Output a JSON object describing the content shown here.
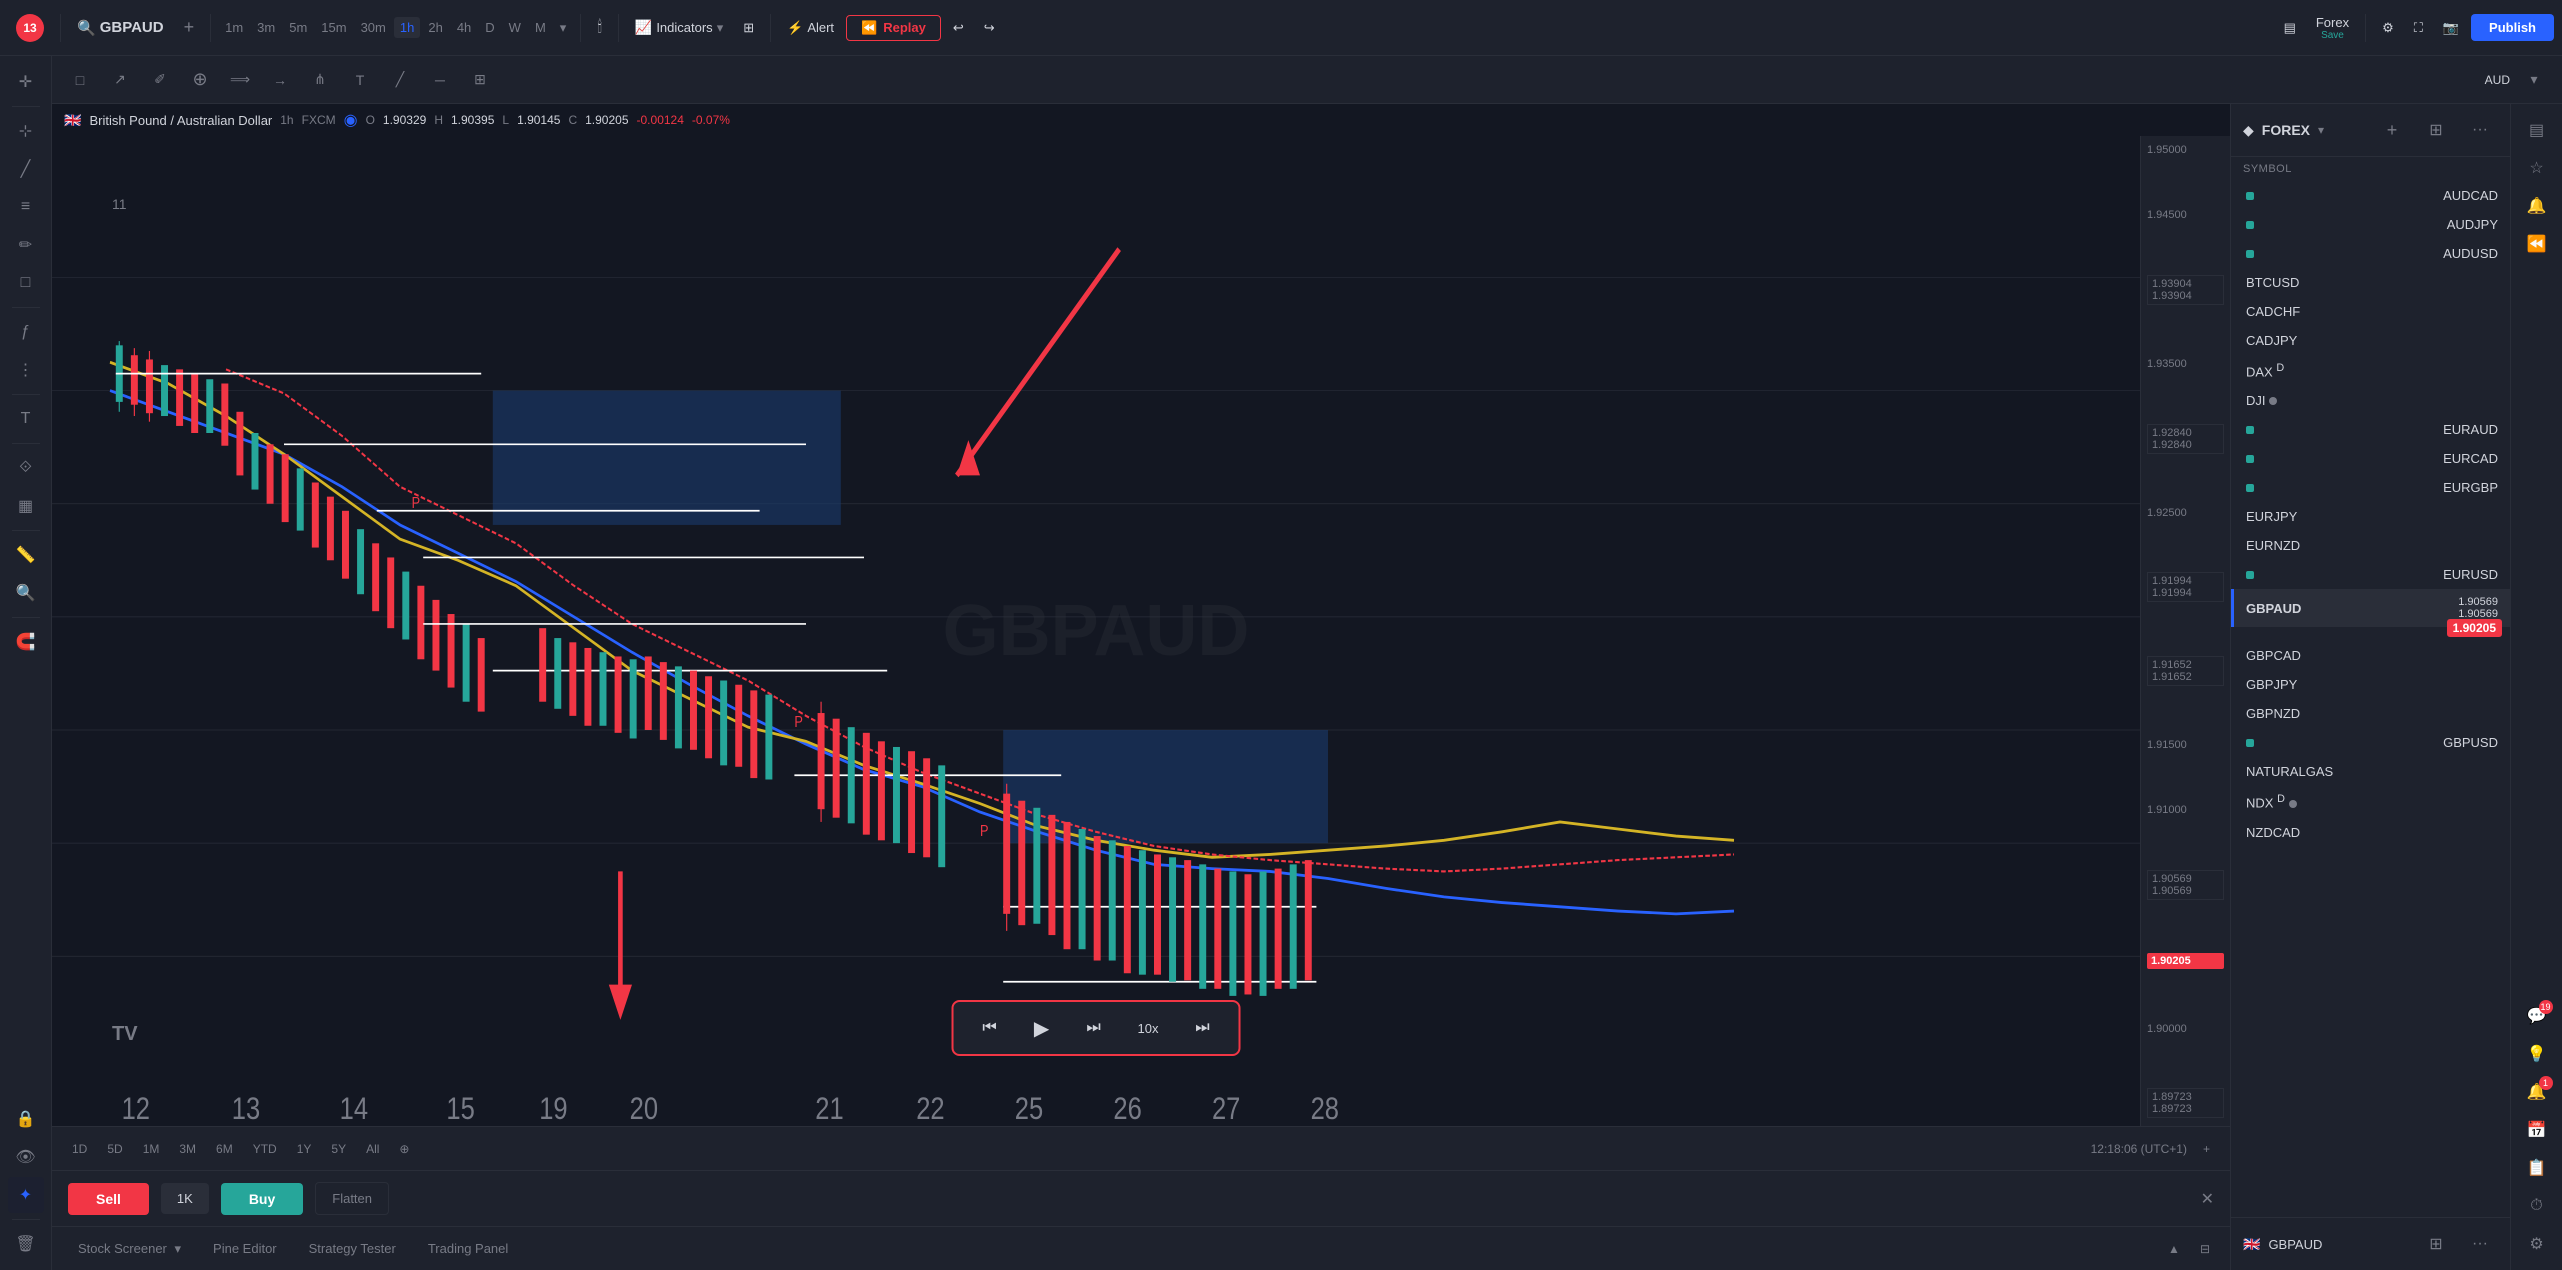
{
  "nav": {
    "symbol": "GBPAUD",
    "timeframes": [
      "1m",
      "3m",
      "5m",
      "15m",
      "30m",
      "1h",
      "2h",
      "4h",
      "D",
      "W",
      "M"
    ],
    "active_tf": "1h",
    "indicators_label": "Indicators",
    "alert_label": "Alert",
    "replay_label": "Replay",
    "publish_label": "Publish",
    "undo_icon": "↩",
    "redo_icon": "↪"
  },
  "chart_header": {
    "pair": "British Pound / Australian Dollar",
    "timeframe": "1h",
    "broker": "FXCM",
    "open": "1.90329",
    "high": "1.90395",
    "low": "1.90145",
    "close": "1.90205",
    "change": "-0.00124",
    "change_pct": "-0.07%",
    "currency": "AUD"
  },
  "price_levels": {
    "top": "1.95000",
    "p1": "1.94500",
    "p2": "1.93500",
    "p3": "1.93904",
    "p4": "1.93904",
    "p5": "1.92840",
    "p6": "1.92840",
    "p7": "1.92500",
    "p8": "1.91994",
    "p9": "1.91994",
    "p10": "1.91652",
    "p11": "1.91652",
    "p12": "1.91500",
    "p13": "1.91000",
    "p14": "1.90569",
    "p15": "1.90569",
    "current": "1.90205",
    "p16": "1.90000",
    "p17": "1.89723",
    "p18": "1.89723"
  },
  "watermark": "11",
  "dates": [
    "12",
    "13",
    "14",
    "15",
    "19",
    "20",
    "21",
    "22",
    "25",
    "26",
    "27",
    "28"
  ],
  "sidebar": {
    "title": "FOREX",
    "section_label": "Symbol",
    "watchlist": [
      {
        "name": "AUDCAD",
        "indicator": "green",
        "price1": "",
        "price2": ""
      },
      {
        "name": "AUDJPY",
        "indicator": "green",
        "price1": "",
        "price2": ""
      },
      {
        "name": "AUDUSD",
        "indicator": "green",
        "price1": "",
        "price2": ""
      },
      {
        "name": "BTCUSD",
        "indicator": "none",
        "price1": "",
        "price2": ""
      },
      {
        "name": "CADCHF",
        "indicator": "none",
        "price1": "",
        "price2": ""
      },
      {
        "name": "CADJPY",
        "indicator": "none",
        "price1": "",
        "price2": ""
      },
      {
        "name": "DAX",
        "indicator": "none",
        "price1": "",
        "price2": "",
        "superscript": "D"
      },
      {
        "name": "DJI",
        "indicator": "dot",
        "price1": "",
        "price2": ""
      },
      {
        "name": "EURAUD",
        "indicator": "green",
        "price1": "",
        "price2": ""
      },
      {
        "name": "EURCAD",
        "indicator": "green",
        "price1": "",
        "price2": ""
      },
      {
        "name": "EURGBP",
        "indicator": "green",
        "price1": "",
        "price2": ""
      },
      {
        "name": "EURJPY",
        "indicator": "none",
        "price1": "",
        "price2": ""
      },
      {
        "name": "EURNZD",
        "indicator": "none",
        "price1": "",
        "price2": ""
      },
      {
        "name": "EURUSD",
        "indicator": "green",
        "price1": "",
        "price2": ""
      },
      {
        "name": "GBPAUD",
        "indicator": "none",
        "price1": "1.90569",
        "price2": "1.90569",
        "active": true
      },
      {
        "name": "GBPCAD",
        "indicator": "none",
        "price1": "",
        "price2": ""
      },
      {
        "name": "GBPJPY",
        "indicator": "none",
        "price1": "",
        "price2": ""
      },
      {
        "name": "GBPNZD",
        "indicator": "none",
        "price1": "",
        "price2": ""
      },
      {
        "name": "GBPUSD",
        "indicator": "green",
        "price1": "",
        "price2": ""
      },
      {
        "name": "NATURALGAS",
        "indicator": "none",
        "price1": "",
        "price2": ""
      },
      {
        "name": "NDX",
        "indicator": "dot",
        "price1": "",
        "price2": "",
        "superscript": "D"
      },
      {
        "name": "NZDCAD",
        "indicator": "none",
        "price1": "",
        "price2": ""
      }
    ]
  },
  "order_bar": {
    "sell_label": "Sell",
    "qty_label": "1K",
    "buy_label": "Buy",
    "flatten_label": "Flatten",
    "current_price": "1.90205"
  },
  "replay_controls": {
    "skip_start": "⏮",
    "play": "▶",
    "step": "⏭",
    "speed": "10x",
    "skip_end": "⏭|"
  },
  "bottom_tabs": [
    {
      "label": "Stock Screener",
      "active": false
    },
    {
      "label": "Pine Editor",
      "active": false
    },
    {
      "label": "Strategy Tester",
      "active": false
    },
    {
      "label": "Trading Panel",
      "active": false
    }
  ],
  "time_display": "12:18:06 (UTC+1)",
  "bottom_symbol": "GBPAUD",
  "logo_text": "TV",
  "tf_buttons": [
    "1D",
    "5D",
    "1M",
    "3M",
    "6M",
    "YTD",
    "1Y",
    "5Y",
    "All"
  ]
}
